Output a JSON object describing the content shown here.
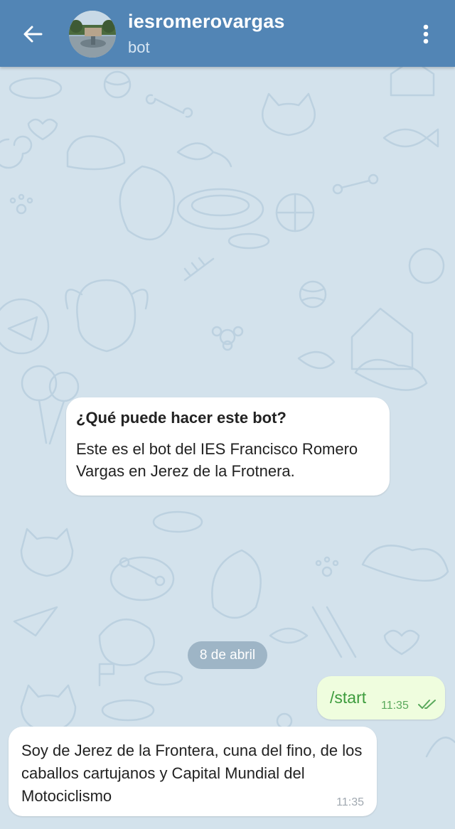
{
  "header": {
    "title": "iesromerovargas",
    "subtitle": "bot",
    "back_icon": "arrow-left-icon",
    "menu_icon": "more-vert-icon",
    "color": "#5285b5"
  },
  "bot_info": {
    "title": "¿Qué puede hacer este bot?",
    "text": "Este es el bot del IES Francisco Romero Vargas en Jerez de la Frotnera."
  },
  "date_separator": "8 de abril",
  "messages": [
    {
      "direction": "outgoing",
      "text": "/start",
      "time": "11:35",
      "status_icon": "double-check-icon"
    },
    {
      "direction": "incoming",
      "text": "Soy de Jerez de la Frontera, cuna del fino, de los caballos cartujanos y Capital Mundial del Motociclismo",
      "time": "11:35"
    }
  ]
}
